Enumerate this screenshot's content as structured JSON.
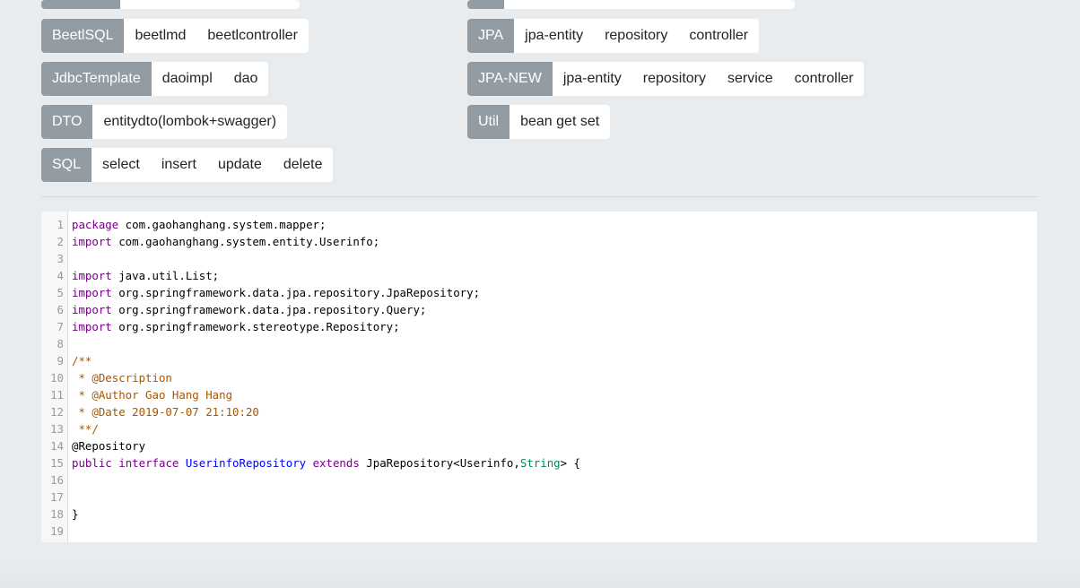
{
  "groups": {
    "topleft_partial": {
      "label": "",
      "options": [
        ""
      ]
    },
    "topright_partial": {
      "label": "",
      "options": [
        ""
      ]
    },
    "beetlsql": {
      "label": "BeetlSQL",
      "options": [
        "beetlmd",
        "beetlcontroller"
      ]
    },
    "jdbctemplate": {
      "label": "JdbcTemplate",
      "options": [
        "daoimpl",
        "dao"
      ]
    },
    "dto": {
      "label": "DTO",
      "options": [
        "entitydto(lombok+swagger)"
      ]
    },
    "sql": {
      "label": "SQL",
      "options": [
        "select",
        "insert",
        "update",
        "delete"
      ]
    },
    "jpa": {
      "label": "JPA",
      "options": [
        "jpa-entity",
        "repository",
        "controller"
      ]
    },
    "jpa_new": {
      "label": "JPA-NEW",
      "options": [
        "jpa-entity",
        "repository",
        "service",
        "controller"
      ]
    },
    "util": {
      "label": "Util",
      "options": [
        "bean get set"
      ]
    }
  },
  "editor": {
    "lines": [
      {
        "n": "1",
        "tokens": [
          {
            "t": "keyword",
            "v": "package"
          },
          {
            "t": "plain",
            "v": " com.gaohanghang.system.mapper;"
          }
        ]
      },
      {
        "n": "2",
        "tokens": [
          {
            "t": "keyword",
            "v": "import"
          },
          {
            "t": "plain",
            "v": " com.gaohanghang.system.entity.Userinfo;"
          }
        ]
      },
      {
        "n": "3",
        "tokens": []
      },
      {
        "n": "4",
        "tokens": [
          {
            "t": "keyword",
            "v": "import"
          },
          {
            "t": "plain",
            "v": " java.util.List;"
          }
        ]
      },
      {
        "n": "5",
        "tokens": [
          {
            "t": "keyword",
            "v": "import"
          },
          {
            "t": "plain",
            "v": " org.springframework.data.jpa.repository.JpaRepository;"
          }
        ]
      },
      {
        "n": "6",
        "tokens": [
          {
            "t": "keyword",
            "v": "import"
          },
          {
            "t": "plain",
            "v": " org.springframework.data.jpa.repository.Query;"
          }
        ]
      },
      {
        "n": "7",
        "tokens": [
          {
            "t": "keyword",
            "v": "import"
          },
          {
            "t": "plain",
            "v": " org.springframework.stereotype.Repository;"
          }
        ]
      },
      {
        "n": "8",
        "tokens": []
      },
      {
        "n": "9",
        "tokens": [
          {
            "t": "comment",
            "v": "/**"
          }
        ]
      },
      {
        "n": "10",
        "tokens": [
          {
            "t": "comment",
            "v": " * @Description"
          }
        ]
      },
      {
        "n": "11",
        "tokens": [
          {
            "t": "comment",
            "v": " * @Author Gao Hang Hang"
          }
        ]
      },
      {
        "n": "12",
        "tokens": [
          {
            "t": "comment",
            "v": " * @Date 2019-07-07 21:10:20"
          }
        ]
      },
      {
        "n": "13",
        "tokens": [
          {
            "t": "comment",
            "v": " **/"
          }
        ]
      },
      {
        "n": "14",
        "tokens": [
          {
            "t": "plain",
            "v": "@Repository"
          }
        ]
      },
      {
        "n": "15",
        "tokens": [
          {
            "t": "keyword",
            "v": "public"
          },
          {
            "t": "plain",
            "v": " "
          },
          {
            "t": "keyword",
            "v": "interface"
          },
          {
            "t": "plain",
            "v": " "
          },
          {
            "t": "def",
            "v": "UserinfoRepository"
          },
          {
            "t": "plain",
            "v": " "
          },
          {
            "t": "keyword",
            "v": "extends"
          },
          {
            "t": "plain",
            "v": " JpaRepository<Userinfo,"
          },
          {
            "t": "type",
            "v": "String"
          },
          {
            "t": "plain",
            "v": "> {"
          }
        ]
      },
      {
        "n": "16",
        "tokens": []
      },
      {
        "n": "17",
        "tokens": []
      },
      {
        "n": "18",
        "tokens": [
          {
            "t": "plain",
            "v": "}"
          }
        ]
      },
      {
        "n": "19",
        "tokens": []
      }
    ]
  }
}
